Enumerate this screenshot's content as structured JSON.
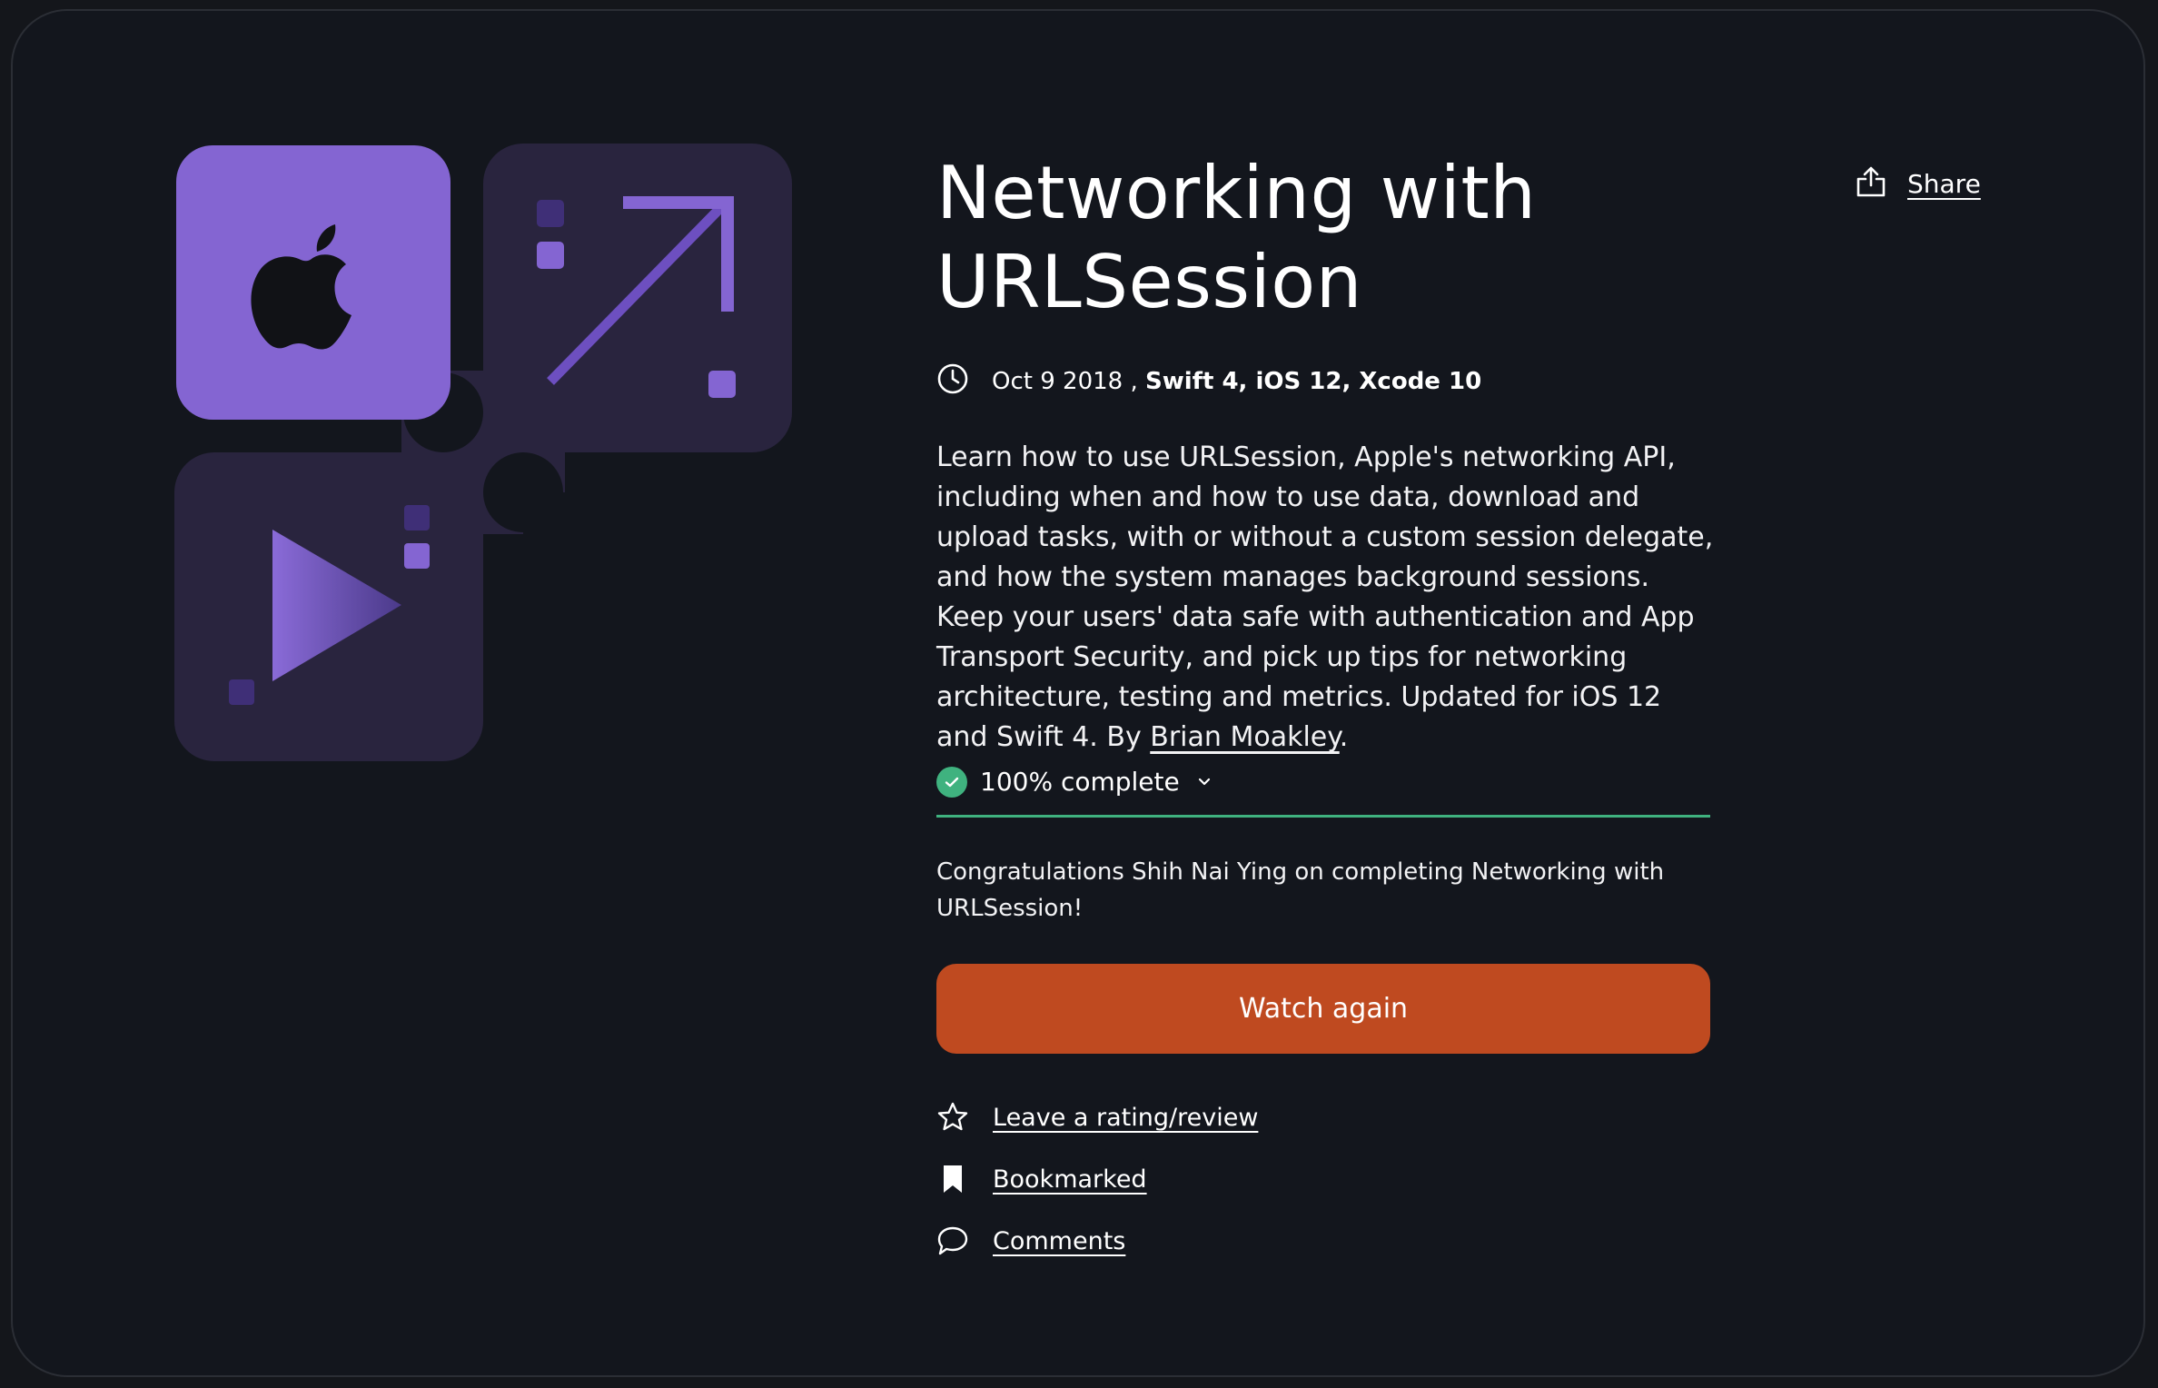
{
  "course": {
    "title_line1": "Networking with",
    "title_line2": "URLSession",
    "date": "Oct 9 2018 ,",
    "tech": "Swift 4, iOS 12, Xcode 10",
    "description": "Learn how to use URLSession, Apple's networking API, including when and how to use data, download and upload tasks, with or without a custom session delegate, and how the system manages background sessions. Keep your users' data safe with authentication and App Transport Security, and pick up tips for networking architecture, testing and metrics. Updated for iOS 12 and Swift 4. By",
    "author": "Brian Moakley",
    "author_suffix": "."
  },
  "share": {
    "label": "Share",
    "icon": "share-icon"
  },
  "progress": {
    "label": "100% complete",
    "value": 1.0,
    "color": "#3fb27f"
  },
  "congrats": "Congratulations Shih Nai Ying on completing Networking with URLSession!",
  "watch_button": {
    "label": "Watch again",
    "color": "#bf4a20"
  },
  "actions": [
    {
      "label": "Leave a rating/review",
      "icon": "star-icon"
    },
    {
      "label": "Bookmarked",
      "icon": "bookmark-icon"
    },
    {
      "label": "Comments",
      "icon": "comment-icon"
    }
  ],
  "colors": {
    "accent_purple": "#8465d2",
    "tile_dark": "#29243e",
    "background": "#13161d"
  }
}
